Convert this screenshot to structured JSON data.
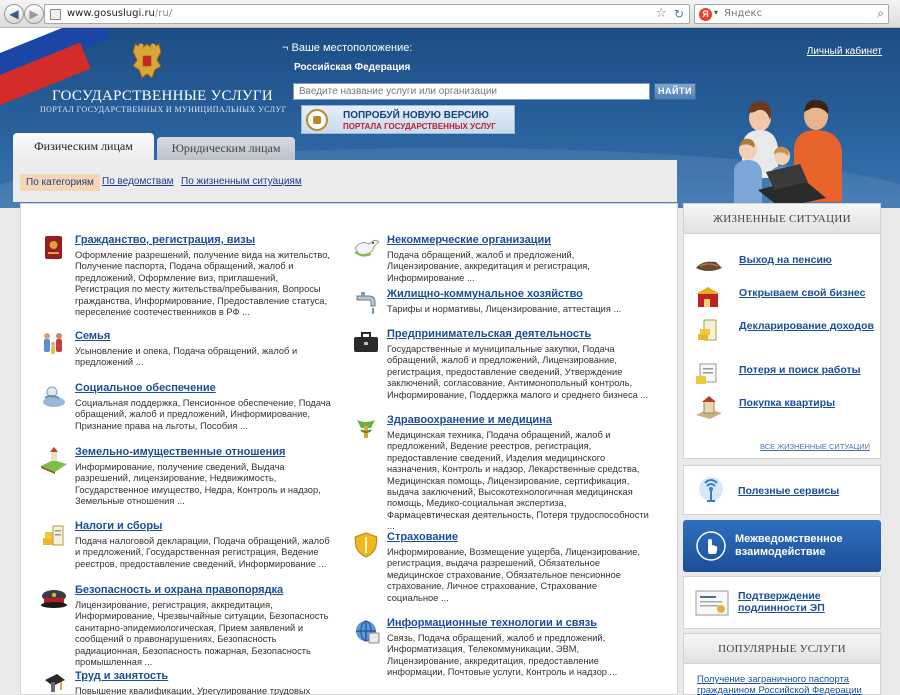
{
  "browser": {
    "url_domain": "www.gosuslugi.ru",
    "url_path": "/ru/",
    "search_placeholder": "Яндекс",
    "search_logo": "Я"
  },
  "header": {
    "title": "ГОСУДАРСТВЕННЫЕ УСЛУГИ",
    "subtitle": "ПОРТАЛ ГОСУДАРСТВЕННЫХ И МУНИЦИПАЛЬНЫХ УСЛУГ",
    "location_label": "Ваше местоположение:",
    "location_value": "Российская Федерация",
    "cabinet_link": "Личный кабинет",
    "search_placeholder": "Введите название услуги или организации",
    "search_button": "НАЙТИ",
    "new_version_line1": "ПОПРОБУЙ НОВУЮ ВЕРСИЮ",
    "new_version_line2": "ПОРТАЛА ГОСУДАРСТВЕННЫХ УСЛУГ"
  },
  "tabs": [
    {
      "label": "Физическим лицам",
      "active": true
    },
    {
      "label": "Юридическим лицам",
      "active": false
    }
  ],
  "filters": [
    {
      "label": "По категориям",
      "active": true
    },
    {
      "label": "По ведомствам",
      "active": false
    },
    {
      "label": "По жизненным ситуациям",
      "active": false
    }
  ],
  "categories_left": [
    {
      "title": "Гражданство, регистрация, визы",
      "desc": "Оформление разрешений, получение вида на жительство, Получение паспорта, Подача обращений, жалоб и предложений, Оформление виз, приглашений, Регистрация по месту жительства/пребывания, Вопросы гражданства, Информирование, Предоставление статуса, переселение соотечественников в РФ ...",
      "icon": "passport-icon"
    },
    {
      "title": "Семья",
      "desc": "Усыновление и опека, Подача обращений, жалоб и предложений ...",
      "icon": "family-icon"
    },
    {
      "title": "Социальное обеспечение",
      "desc": "Социальная поддержка, Пенсионное обеспечение, Подача обращений, жалоб и предложений, Информирование, Признание права на льготы, Пособия ...",
      "icon": "social-support-icon"
    },
    {
      "title": "Земельно-имущественные отношения",
      "desc": "Информирование, получение сведений, Выдача разрешений, лицензирование, Недвижимость, Государственное имущество, Недра, Контроль и надзор, Земельные отношения ...",
      "icon": "land-icon"
    },
    {
      "title": "Налоги и сборы",
      "desc": "Подача налоговой декларации, Подача обращений, жалоб и предложений, Государственная регистрация, Ведение реестров, предоставление сведений, Информирование ...",
      "icon": "taxes-icon"
    },
    {
      "title": "Безопасность и охрана правопорядка",
      "desc": "Лицензирование, регистрация, аккредитация, Информирование, Чрезвычайные ситуации, Безопасность санитарно-эпидемиологическая, Прием заявлений и сообщений о правонарушениях, Безопасность радиационная, Безопасность пожарная, Безопасность промышленная ...",
      "icon": "police-cap-icon"
    },
    {
      "title": "Труд и занятость",
      "desc": "Повышение квалификации, Урегулирование трудовых споров,",
      "icon": "work-icon"
    }
  ],
  "categories_right": [
    {
      "title": "Некоммерческие организации",
      "desc": "Подача обращений, жалоб и предложений, Лицензирование, аккредитация и регистрация, Информирование ...",
      "icon": "dove-icon"
    },
    {
      "title": "Жилищно-коммунальное хозяйство",
      "desc": "Тарифы и нормативы, Лицензирование, аттестация ...",
      "icon": "faucet-icon"
    },
    {
      "title": "Предпринимательская деятельность",
      "desc": "Государственные и муниципальные закупки, Подача обращений, жалоб и предложений, Лицензирование, регистрация, предоставление сведений, Утверждение заключений, согласование, Антимонопольный контроль, Информирование, Поддержка малого и среднего бизнеса ...",
      "icon": "briefcase-icon"
    },
    {
      "title": "Здравоохранение и медицина",
      "desc": "Медицинская техника, Подача обращений, жалоб и предложений, Ведение реестров, регистрация, предоставление сведений, Изделия медицинского назначения, Контроль и надзор, Лекарственные средства, Медицинская помощь, Лицензирование, сертификация, выдача заключений, Высокотехнологичная медицинская помощь, Медико-социальная экспертиза, Фармацевтическая деятельность, Потеря трудоспособности ...",
      "icon": "medicine-icon"
    },
    {
      "title": "Страхование",
      "desc": "Информирование, Возмещение ущерба, Лицензирование, регистрация, выдача разрешений, Обязательное медицинское страхование, Обязательное пенсионное страхование, Личное страхование, Страхование социальное ...",
      "icon": "insurance-icon"
    },
    {
      "title": "Информационные технологии и связь",
      "desc": "Связь, Подача обращений, жалоб и предложений, Информатизация, Телекоммуникации, ЭВМ, Лицензирование, аккредитация, предоставление информации, Почтовые услуги, Контроль и надзор ...",
      "icon": "it-icon"
    }
  ],
  "sidebar": {
    "life_title": "ЖИЗНЕННЫЕ СИТУАЦИИ",
    "life_items": [
      {
        "label": "Выход на пенсию",
        "icon": "retirement-icon"
      },
      {
        "label": "Открываем свой бизнес",
        "icon": "business-icon"
      },
      {
        "label": "Декларирование доходов",
        "icon": "declaration-icon"
      },
      {
        "label": "Потеря и поиск работы",
        "icon": "job-search-icon"
      },
      {
        "label": "Покупка квартиры",
        "icon": "apartment-icon"
      }
    ],
    "all_life": "ВСЕ ЖИЗНЕННЫЕ СИТУАЦИИ",
    "services": "Полезные сервисы",
    "interagency": "Межведомственное взаимодействие",
    "ep": "Подтверждение подлинности ЭП",
    "popular_title": "ПОПУЛЯРНЫЕ УСЛУГИ",
    "popular_link": "Получение заграничного паспорта гражданином Российской Федерации"
  }
}
